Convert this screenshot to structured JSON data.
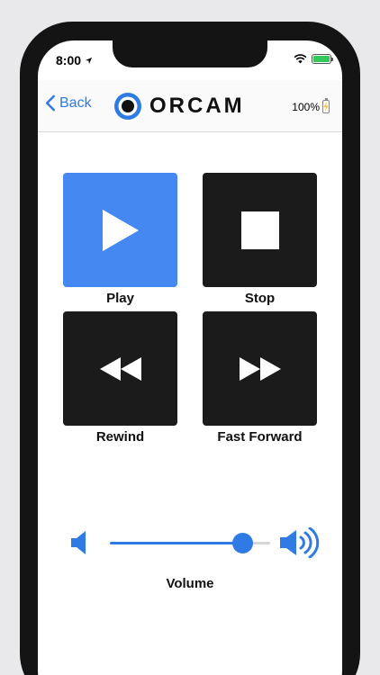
{
  "status": {
    "time": "8:00"
  },
  "nav": {
    "back_label": "Back",
    "logo_text": "ORCAM",
    "battery_percent": "100%"
  },
  "controls": [
    {
      "label": "Play",
      "icon": "play-icon",
      "active": true
    },
    {
      "label": "Stop",
      "icon": "stop-icon",
      "active": false
    },
    {
      "label": "Rewind",
      "icon": "rewind-icon",
      "active": false
    },
    {
      "label": "Fast Forward",
      "icon": "fast-forward-icon",
      "active": false
    }
  ],
  "volume": {
    "label": "Volume",
    "level": 0.83
  },
  "colors": {
    "accent": "#2f7ae5",
    "play_tile": "#4588f2",
    "tile": "#1b1b1b"
  }
}
